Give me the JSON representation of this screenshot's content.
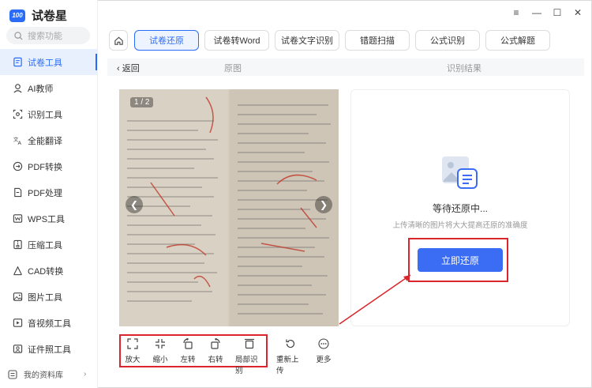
{
  "app": {
    "logo_badge": "100",
    "name": "试卷星"
  },
  "search": {
    "placeholder": "搜索功能"
  },
  "sidebar": {
    "items": [
      {
        "label": "试卷工具",
        "icon": "document-tool-icon",
        "active": true
      },
      {
        "label": "AI教师",
        "icon": "ai-teacher-icon",
        "active": false
      },
      {
        "label": "识别工具",
        "icon": "scan-icon",
        "active": false
      },
      {
        "label": "全能翻译",
        "icon": "translate-icon",
        "active": false
      },
      {
        "label": "PDF转换",
        "icon": "pdf-convert-icon",
        "active": false
      },
      {
        "label": "PDF处理",
        "icon": "pdf-process-icon",
        "active": false
      },
      {
        "label": "WPS工具",
        "icon": "wps-icon",
        "active": false
      },
      {
        "label": "压缩工具",
        "icon": "compress-icon",
        "active": false
      },
      {
        "label": "CAD转换",
        "icon": "cad-icon",
        "active": false
      },
      {
        "label": "图片工具",
        "icon": "image-icon",
        "active": false
      },
      {
        "label": "音视频工具",
        "icon": "media-icon",
        "active": false
      },
      {
        "label": "证件照工具",
        "icon": "id-photo-icon",
        "active": false
      }
    ],
    "library_label": "我的资料库"
  },
  "tabs": [
    {
      "label": "试卷还原",
      "active": true
    },
    {
      "label": "试卷转Word",
      "active": false
    },
    {
      "label": "试卷文字识别",
      "active": false
    },
    {
      "label": "错题扫描",
      "active": false
    },
    {
      "label": "公式识别",
      "active": false
    },
    {
      "label": "公式解题",
      "active": false
    }
  ],
  "content": {
    "back_label": "返回",
    "original_label": "原图",
    "result_label": "识别结果",
    "image_counter": "1 / 2"
  },
  "result": {
    "status": "等待还原中...",
    "hint": "上传清晰的图片将大大提高还原的准确度",
    "restore_button": "立即还原"
  },
  "toolbar": {
    "zoom_in": "放大",
    "zoom_out": "缩小",
    "rotate_left": "左转",
    "rotate_right": "右转",
    "partial_recognize": "局部识别",
    "reupload": "重新上传",
    "more": "更多"
  },
  "colors": {
    "accent": "#2b6cf6",
    "highlight": "#d9252b",
    "button": "#3a6cf4"
  }
}
